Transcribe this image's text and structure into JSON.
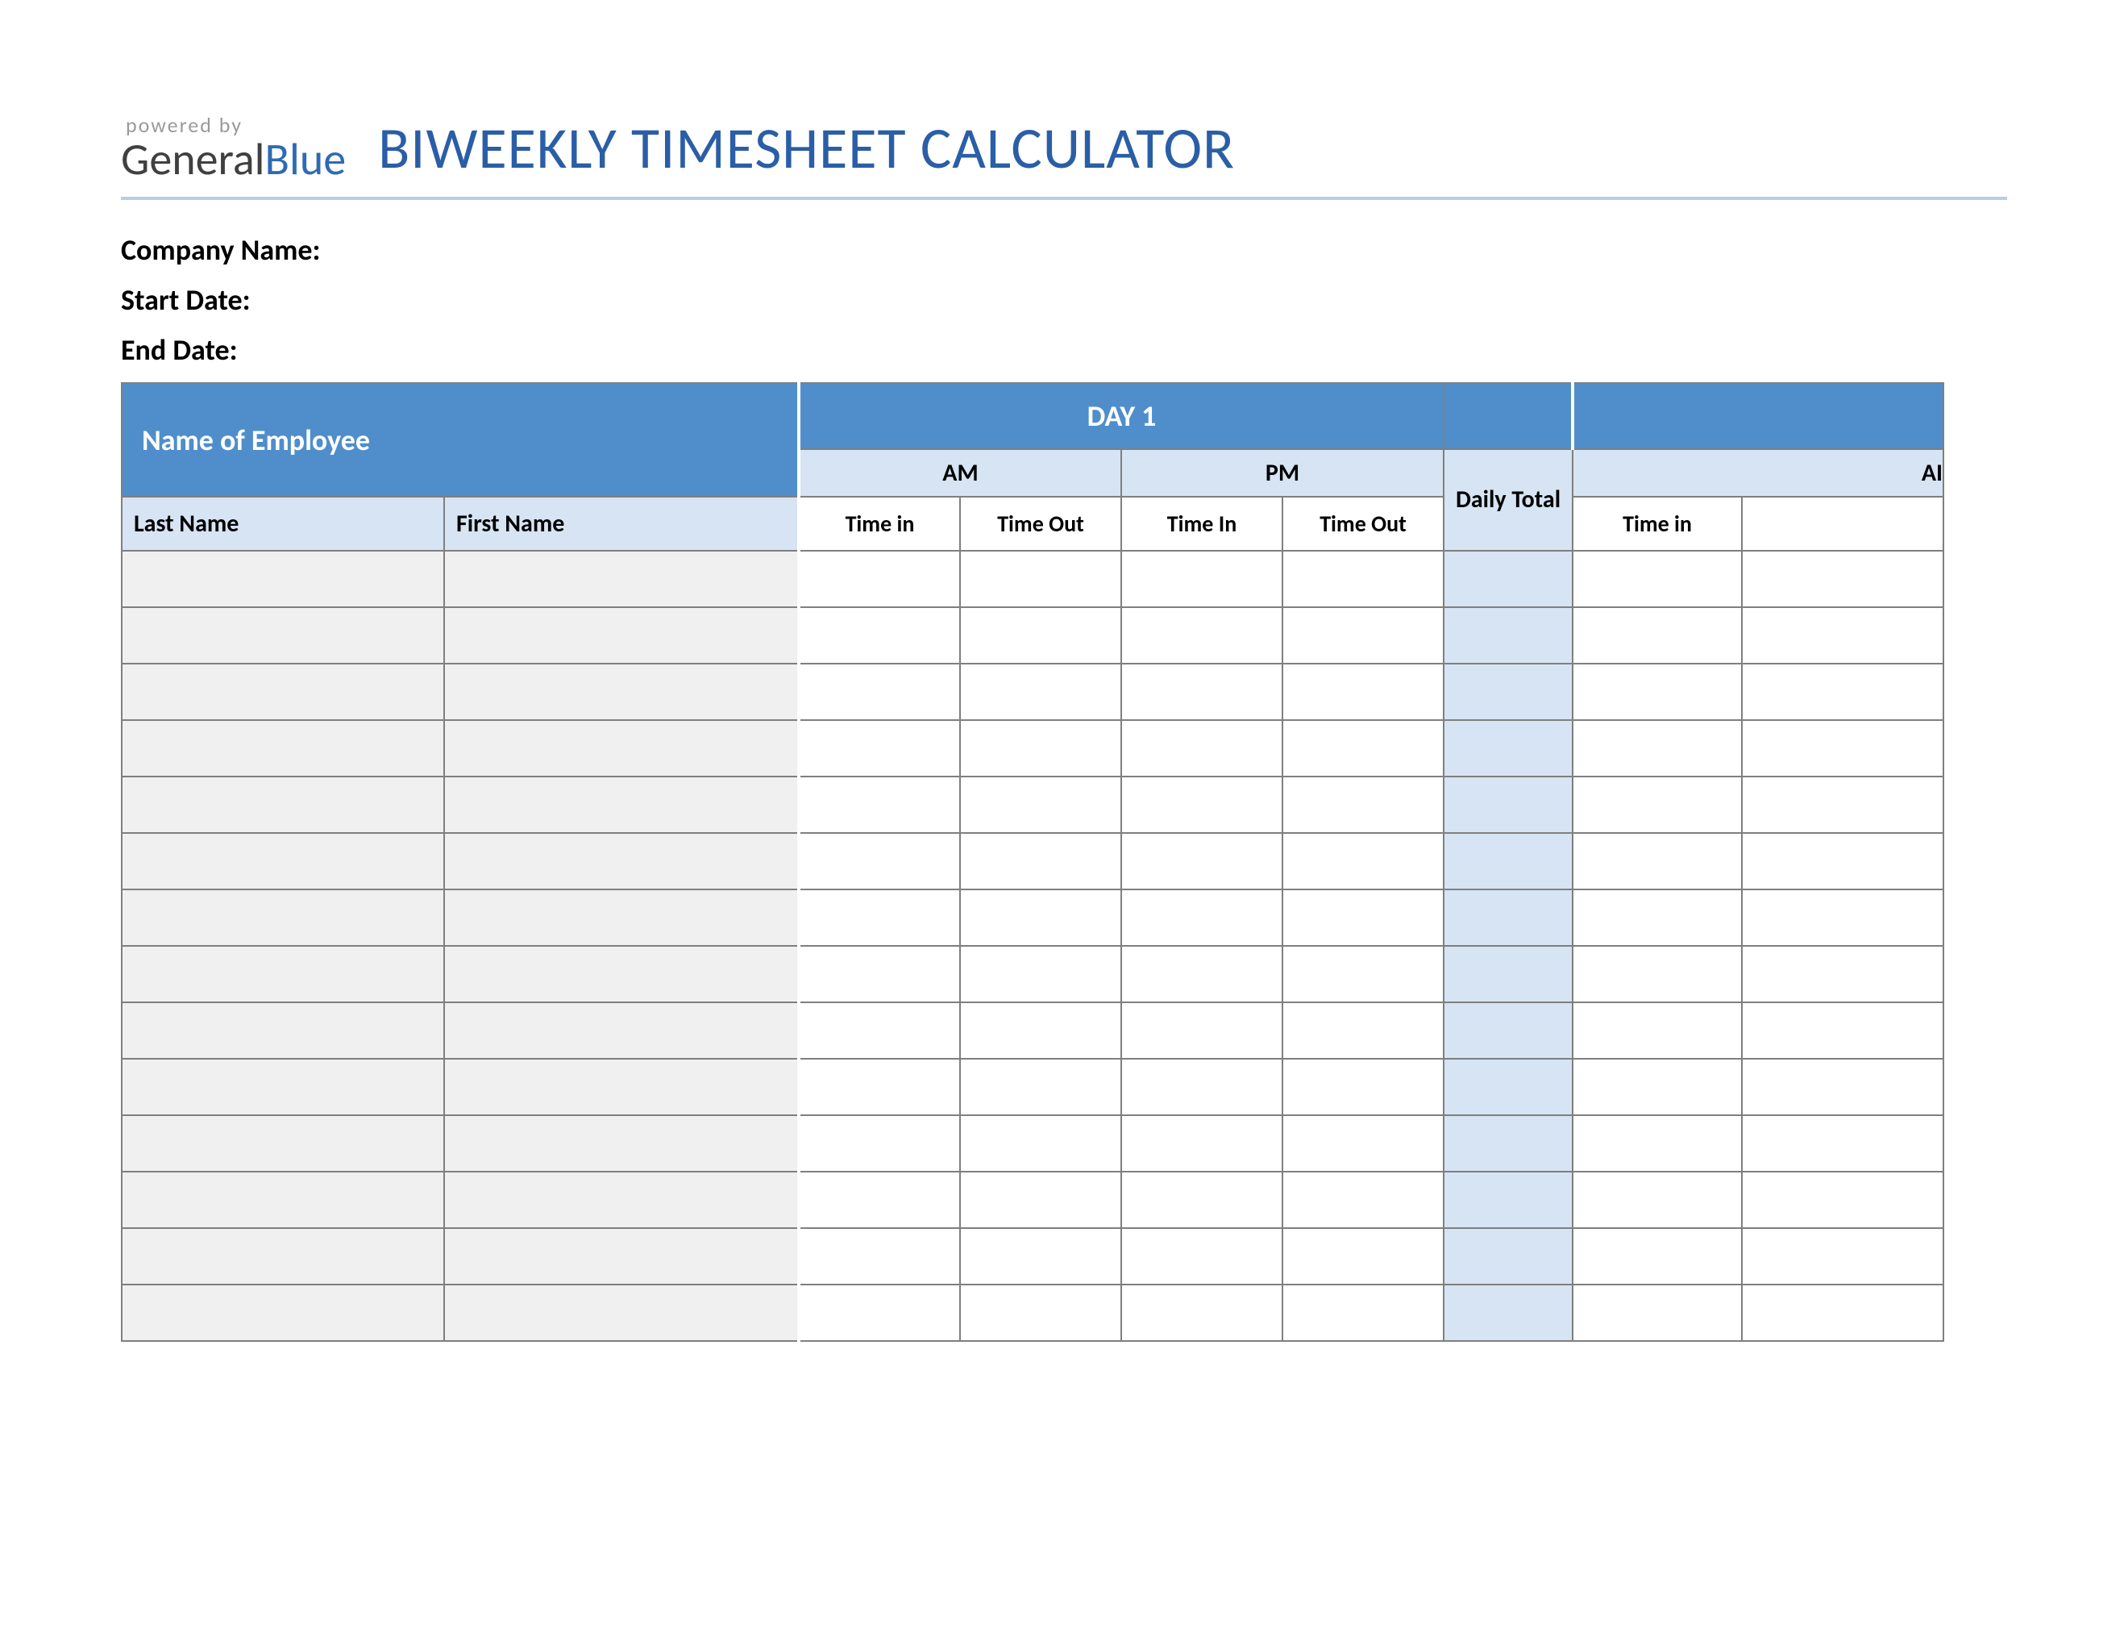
{
  "logo": {
    "powered": "powered by",
    "name_part1": "General",
    "name_part2": "Blue"
  },
  "title": "BIWEEKLY TIMESHEET CALCULATOR",
  "meta": {
    "company_label": "Company Name:",
    "start_label": "Start Date:",
    "end_label": "End Date:"
  },
  "headers": {
    "employee": "Name of Employee",
    "day1": "DAY 1",
    "am": "AM",
    "pm": "PM",
    "daily_total": "Daily Total",
    "last_name": "Last Name",
    "first_name": "First Name",
    "time_in": "Time in",
    "time_in_cap": "Time In",
    "time_out": "Time Out",
    "am_partial": "AI"
  },
  "row_count": 14
}
